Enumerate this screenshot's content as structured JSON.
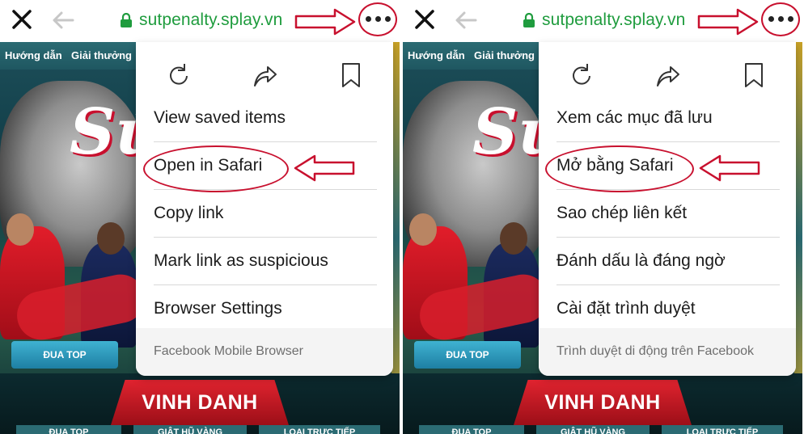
{
  "colors": {
    "url_green": "#1f9c3e",
    "annotation_red": "#c8102e",
    "menu_text": "#1c1c1c",
    "footer_text": "#6e6e6e"
  },
  "icons": {
    "close": "close-icon",
    "back": "back-arrow-icon",
    "lock": "lock-icon",
    "more": "more-dots-icon",
    "reload": "reload-icon",
    "share": "share-icon",
    "bookmark": "bookmark-icon"
  },
  "left": {
    "url": "sutpenalty.splay.vn",
    "background": {
      "nav": [
        "Hướng dẫn",
        "Giải thưởng"
      ],
      "dua_top": "ĐUA TOP",
      "vinh_danh": "VINH DANH",
      "sub_tabs": [
        "ĐUA TOP",
        "GIẬT HŨ VÀNG",
        "LOẠI TRỰC TIẾP"
      ]
    },
    "menu": {
      "items": [
        "View saved items",
        "Open in Safari",
        "Copy link",
        "Mark link as suspicious",
        "Browser Settings"
      ],
      "footer": "Facebook Mobile Browser"
    }
  },
  "right": {
    "url": "sutpenalty.splay.vn",
    "background": {
      "nav": [
        "Hướng dẫn",
        "Giải thưởng"
      ],
      "dua_top": "ĐUA TOP",
      "vinh_danh": "VINH DANH",
      "sub_tabs": [
        "ĐUA TOP",
        "GIẬT HŨ VÀNG",
        "LOẠI TRỰC TIẾP"
      ]
    },
    "menu": {
      "items": [
        "Xem các mục đã lưu",
        "Mở bằng Safari",
        "Sao chép liên kết",
        "Đánh dấu là đáng ngờ",
        "Cài đặt trình duyệt"
      ],
      "footer": "Trình duyệt di động trên Facebook"
    }
  }
}
